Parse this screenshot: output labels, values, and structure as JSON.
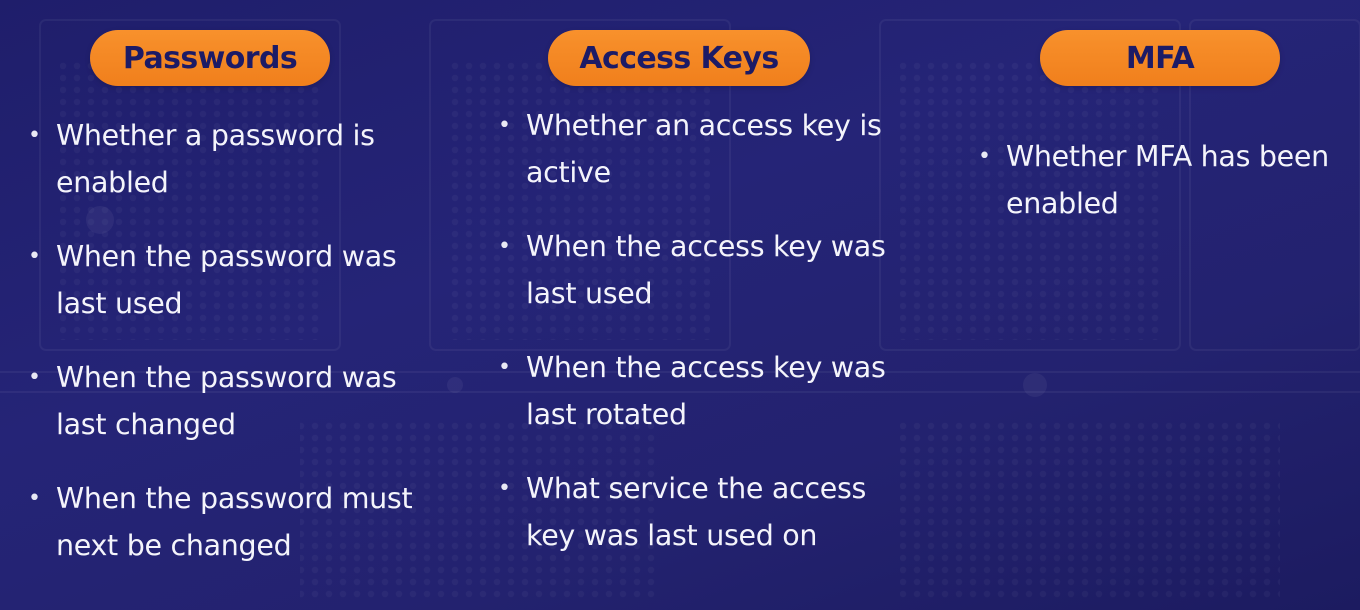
{
  "colors": {
    "background": "#23226f",
    "pill": "#f6892a",
    "pill_text": "#1c1b66",
    "text": "#ffffff"
  },
  "columns": [
    {
      "title": "Passwords",
      "items": [
        "Whether a password is enabled",
        "When the password was last used",
        "When the password was last changed",
        "When the password must next be changed"
      ]
    },
    {
      "title": "Access Keys",
      "items": [
        "Whether an access key is active",
        "When the access key was last used",
        "When the access key was last rotated",
        "What service the access key was last used on"
      ]
    },
    {
      "title": "MFA",
      "items": [
        "Whether MFA has been enabled"
      ]
    }
  ]
}
